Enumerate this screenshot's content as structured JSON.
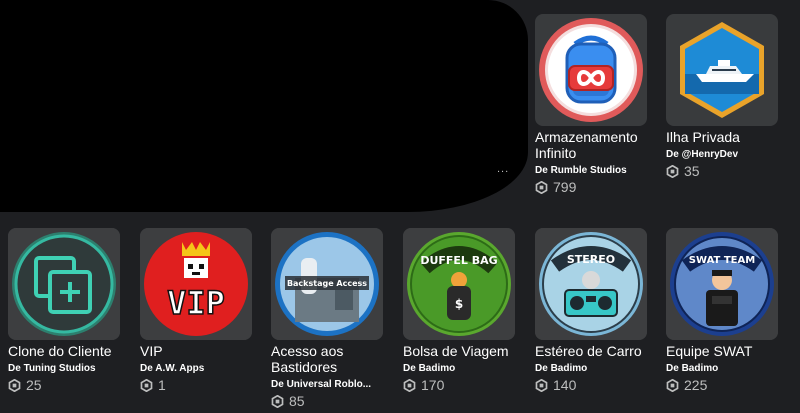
{
  "colors": {
    "background": "#1e1f22",
    "card": "#393b3d",
    "price_text": "#bdbebe"
  },
  "items": [
    {
      "name": "Armazenamento Infinito",
      "creator": "Rumble Studios",
      "price": "799",
      "icon": "infinity-backpack-icon"
    },
    {
      "name": "Ilha Privada",
      "creator": "@HenryDev",
      "price": "35",
      "icon": "yacht-hexagon-icon"
    },
    {
      "name": "Clone do Cliente",
      "creator": "Tuning Studios",
      "price": "25",
      "icon": "clone-plus-icon"
    },
    {
      "name": "VIP",
      "creator": "A.W. Apps",
      "price": "1",
      "icon": "vip-crown-icon"
    },
    {
      "name": "Acesso aos Bastidores",
      "creator": "Universal Roblo...",
      "price": "85",
      "icon": "backstage-access-icon"
    },
    {
      "name": "Bolsa de Viagem",
      "creator": "Badimo",
      "price": "170",
      "icon": "duffel-bag-icon"
    },
    {
      "name": "Estéreo de Carro",
      "creator": "Badimo",
      "price": "140",
      "icon": "stereo-boombox-icon"
    },
    {
      "name": "Equipe SWAT",
      "creator": "Badimo",
      "price": "225",
      "icon": "swat-team-icon"
    }
  ],
  "labels": {
    "by_prefix": "De",
    "badge_duffel": "DUFFEL BAG",
    "badge_stereo": "STEREO",
    "badge_swat": "SWAT TEAM",
    "badge_backstage": "Backstage Access",
    "badge_vip": "VIP",
    "occluded_ellipsis": "..."
  }
}
